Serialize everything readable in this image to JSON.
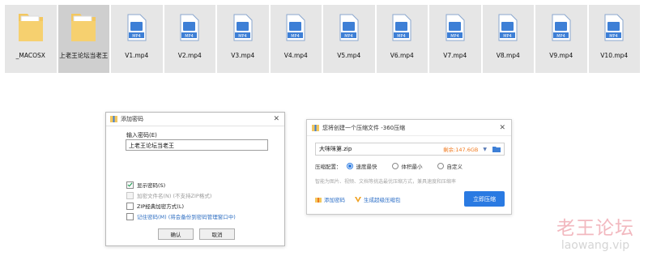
{
  "files": [
    {
      "name": "_MACOSX",
      "kind": "folder",
      "selected": false
    },
    {
      "name": "上老王论坛当老王",
      "kind": "folder",
      "selected": true
    },
    {
      "name": "V1.mp4",
      "kind": "mp4"
    },
    {
      "name": "V2.mp4",
      "kind": "mp4"
    },
    {
      "name": "V3.mp4",
      "kind": "mp4"
    },
    {
      "name": "V4.mp4",
      "kind": "mp4"
    },
    {
      "name": "V5.mp4",
      "kind": "mp4"
    },
    {
      "name": "V6.mp4",
      "kind": "mp4"
    },
    {
      "name": "V7.mp4",
      "kind": "mp4"
    },
    {
      "name": "V8.mp4",
      "kind": "mp4"
    },
    {
      "name": "V9.mp4",
      "kind": "mp4"
    },
    {
      "name": "V10.mp4",
      "kind": "mp4"
    }
  ],
  "file_badge": "MP4",
  "password_dialog": {
    "title": "添加密码",
    "close_glyph": "✕",
    "input_label": "输入密码(E)",
    "input_value": "上老王论坛当老王",
    "options": {
      "show_password": {
        "label": "显示密码(S)",
        "checked": true
      },
      "encrypt_filenames": {
        "label": "加密文件名(N)  (不支持ZIP格式)",
        "checked": false
      },
      "zip_classic": {
        "label": "ZIP经典加密方式(L)",
        "checked": false
      },
      "remember": {
        "label": "记住密码(M)  (将会备份到密码管理窗口中)",
        "checked": false
      }
    },
    "ok_label": "确认",
    "cancel_label": "取消"
  },
  "compress_dialog": {
    "title": "您将创建一个压缩文件 -360压缩",
    "close_glyph": "✕",
    "filename": "大咪咪第.zip",
    "remaining": "剩余:147.6GB",
    "caret_glyph": "▼",
    "config_label": "压缩配置：",
    "radios": [
      {
        "label": "速度最快",
        "selected": true
      },
      {
        "label": "体积最小",
        "selected": false
      },
      {
        "label": "自定义",
        "selected": false
      }
    ],
    "hint": "智能为图片、视频、文档等挑选最优压缩方式，兼具速度和压缩率",
    "add_password": "添加密码",
    "super_package": "生成超级压缩包",
    "primary_label": "立即压缩"
  },
  "watermark": {
    "line1": "老王论坛",
    "line2": "laowang.vip"
  },
  "colors": {
    "accent": "#2a7ae2",
    "orange": "#f07a1f",
    "folder": "#f3c75f",
    "mp4_blue": "#3d7fd6"
  }
}
